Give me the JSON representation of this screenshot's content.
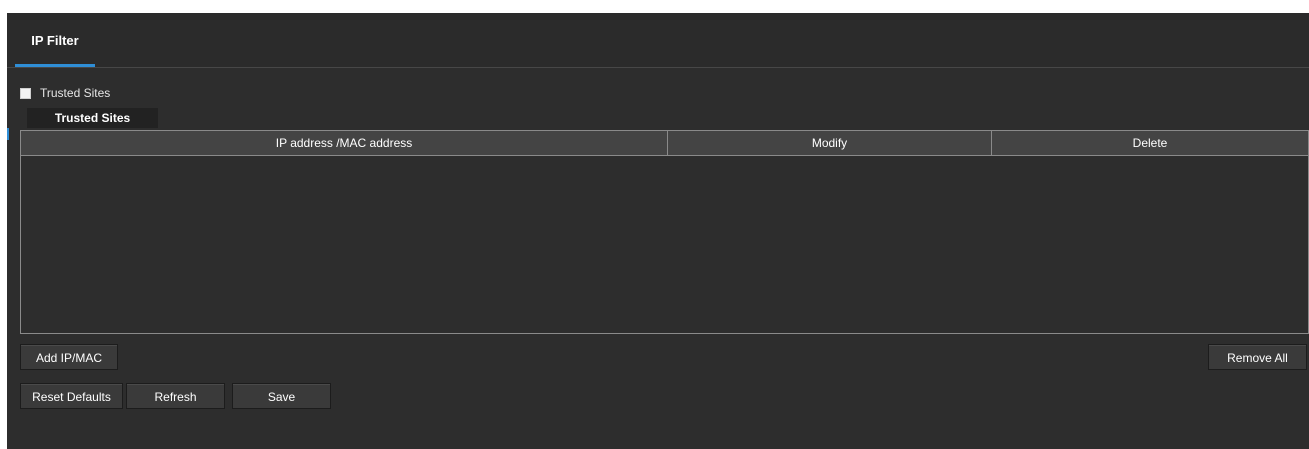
{
  "tabs": [
    {
      "label": "IP Filter",
      "active": true
    }
  ],
  "trusted_checkbox": {
    "label": "Trusted Sites",
    "checked": false
  },
  "section": {
    "title": "Trusted Sites"
  },
  "table": {
    "columns": [
      "IP address /MAC address",
      "Modify",
      "Delete"
    ],
    "rows": []
  },
  "buttons": {
    "add": "Add IP/MAC",
    "remove_all": "Remove All",
    "reset_defaults": "Reset Defaults",
    "refresh": "Refresh",
    "save": "Save"
  },
  "colors": {
    "background": "#2d2d2d",
    "accent": "#2f8ed6",
    "table_header": "#444444",
    "button": "#3a3a3a",
    "text": "#ffffff"
  }
}
